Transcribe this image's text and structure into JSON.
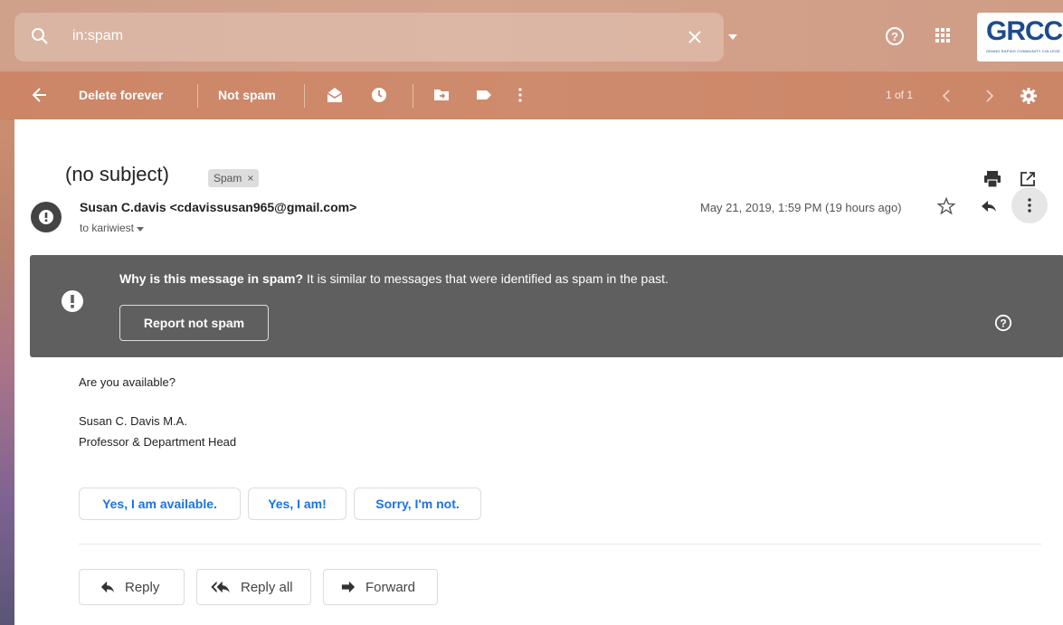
{
  "search": {
    "query": "in:spam"
  },
  "logo": {
    "text": "GRCC",
    "subtext": "GRAND RAPIDS COMMUNITY COLLEGE"
  },
  "toolbar": {
    "delete_label": "Delete forever",
    "not_spam_label": "Not spam",
    "pager": "1 of 1"
  },
  "message": {
    "subject": "(no subject)",
    "label": "Spam",
    "label_close": "×",
    "sender": "Susan C.davis <cdavissusan965@gmail.com>",
    "to": "to kariwiest",
    "date": "May 21, 2019, 1:59 PM (19 hours ago)"
  },
  "warning": {
    "bold": "Why is this message in spam?",
    "text": " It is similar to messages that were identified as spam in the past.",
    "button": "Report not spam"
  },
  "body": {
    "line1": "Are you available?",
    "sig_name": "Susan C. Davis M.A.",
    "sig_title": "Professor & Department Head"
  },
  "smart_replies": [
    "Yes, I am available.",
    "Yes, I am!",
    "Sorry, I'm not."
  ],
  "actions": {
    "reply": "Reply",
    "reply_all": "Reply all",
    "forward": "Forward"
  },
  "colors": {
    "header": "#cf9c86",
    "toolbar": "#cc8567",
    "warning": "#5f5f5f",
    "link_blue": "#1a73e8"
  }
}
